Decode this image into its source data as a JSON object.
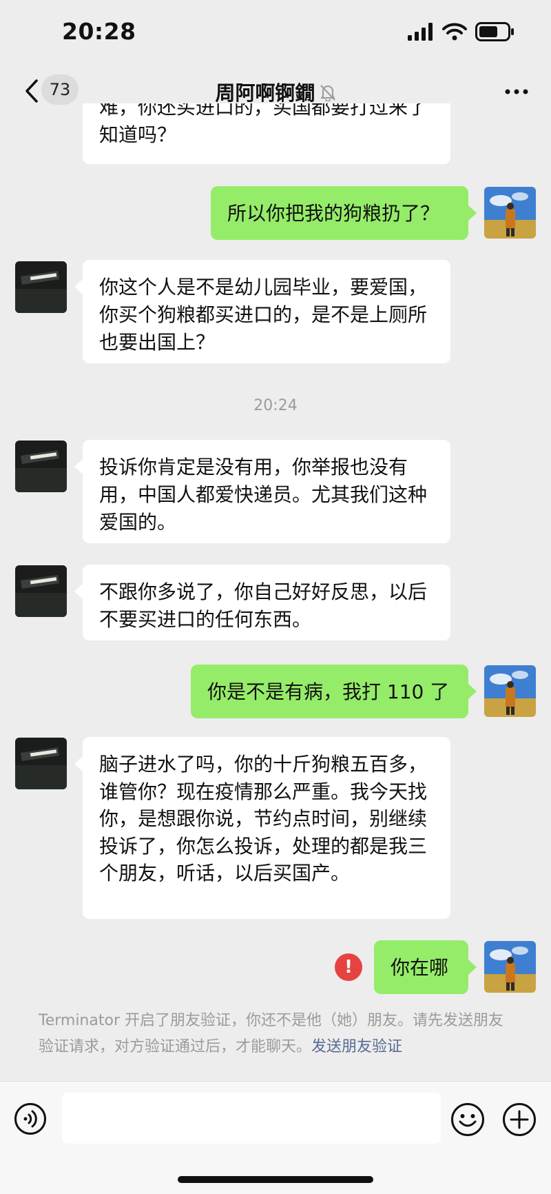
{
  "status_bar": {
    "time": "20:28"
  },
  "nav": {
    "unread_count": "73",
    "title": "周阿啊锕鐗"
  },
  "messages": [
    {
      "text": "难，你还买进口的，买国都要打过来了知道吗？"
    },
    {
      "text": "所以你把我的狗粮扔了？"
    },
    {
      "text": "你这个人是不是幼儿园毕业，要爱国，你买个狗粮都买进口的，是不是上厕所也要出国上？"
    },
    {
      "text": "投诉你肯定是没有用，你举报也没有用，中国人都爱快递员。尤其我们这种爱国的。"
    },
    {
      "text": "不跟你多说了，你自己好好反思，以后不要买进口的任何东西。"
    },
    {
      "text": "你是不是有病，我打 110 了"
    },
    {
      "text": "脑子进水了吗，你的十斤狗粮五百多，谁管你？现在疫情那么严重。我今天找你，是想跟你说，节约点时间，别继续投诉了，你怎么投诉，处理的都是我三个朋友，听话，以后买国产。"
    },
    {
      "text": "你在哪"
    }
  ],
  "timestamp": "20:24",
  "system_notice": {
    "text": "Terminator 开启了朋友验证，你还不是他（她）朋友。请先发送朋友验证请求，对方验证通过后，才能聊天。",
    "link": "发送朋友验证"
  },
  "input": {
    "placeholder": "",
    "value": ""
  },
  "icons": {
    "signal": "signal-icon",
    "wifi": "wifi-icon",
    "battery": "battery-icon",
    "back": "chevron-left-icon",
    "mute": "bell-off-icon",
    "more": "more-dots-icon",
    "fail": "send-failed-icon",
    "voice": "voice-icon",
    "emoji": "emoji-icon",
    "plus": "plus-icon"
  },
  "colors": {
    "incoming_bubble": "#ffffff",
    "outgoing_bubble": "#95ec69",
    "fail": "#e64340",
    "link": "#576b95",
    "background": "#ededed"
  }
}
